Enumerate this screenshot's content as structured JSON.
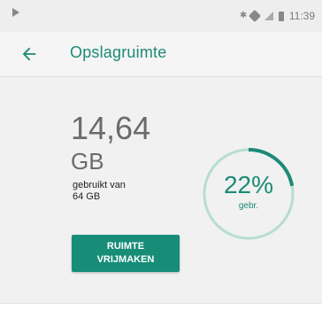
{
  "status_bar": {
    "time": "11:39",
    "icons": [
      "play-icon",
      "bluetooth-icon",
      "heart-icon",
      "signal-icon",
      "battery-icon"
    ]
  },
  "toolbar": {
    "title": "Opslagruimte",
    "back_icon": "arrow-back-icon"
  },
  "storage": {
    "used_amount": "14,64",
    "used_unit": "GB",
    "used_of_label": "gebruikt van",
    "total": "64 GB",
    "free_button_line1": "RUIMTE",
    "free_button_line2": "VRIJMAKEN",
    "percent_text": "22%",
    "percent_label": "gebr.",
    "percent_value": 0.22
  },
  "colors": {
    "accent": "#1b8a76",
    "button": "#178d78",
    "gauge_track": "#b7ddd3"
  }
}
